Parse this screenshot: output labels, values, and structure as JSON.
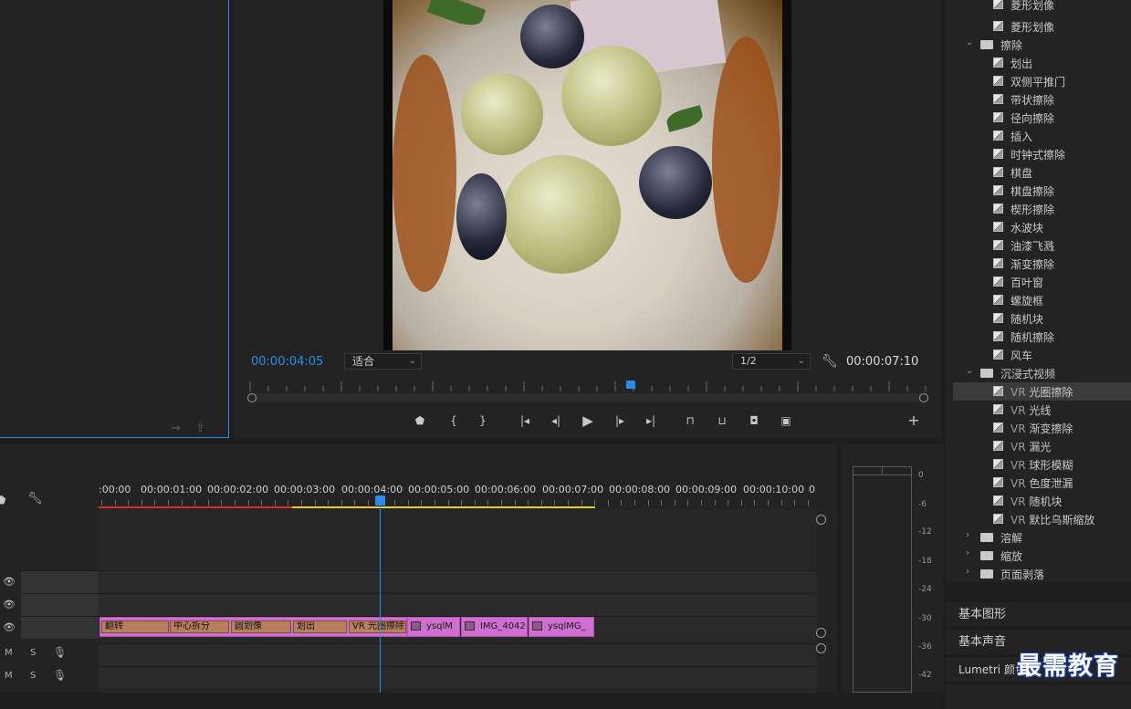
{
  "program_monitor": {
    "timecode_current": "00:00:04:05",
    "fit_select": "适合",
    "resolution_select": "1/2",
    "timecode_duration": "00:00:07:10",
    "playhead_fraction": 0.567
  },
  "timeline": {
    "ruler_labels": [
      ":00:00",
      "00:00:01:00",
      "00:00:02:00",
      "00:00:03:00",
      "00:00:04:00",
      "00:00:05:00",
      "00:00:06:00",
      "00:00:07:00",
      "00:00:08:00",
      "00:00:09:00",
      "00:00:10:00",
      "0"
    ],
    "transitions": [
      "翻转",
      "中心拆分",
      "圆划像",
      "划出",
      "VR 光圈擦除"
    ],
    "clips": [
      "ysqlM",
      "IMG_4042",
      "ysqlMG_"
    ],
    "track_m": "M",
    "track_s": "S"
  },
  "audio_meter": {
    "db_labels": [
      "0",
      "-6",
      "-12",
      "-18",
      "-24",
      "-30",
      "-36",
      "-42"
    ]
  },
  "effects": {
    "top_items": [
      "菱形划像",
      "菱形划像"
    ],
    "wipe_folder": "擦除",
    "wipe_items": [
      "划出",
      "双侧平推门",
      "带状擦除",
      "径向擦除",
      "插入",
      "时钟式擦除",
      "棋盘",
      "棋盘擦除",
      "楔形擦除",
      "水波块",
      "油漆飞溅",
      "渐变擦除",
      "百叶窗",
      "螺旋框",
      "随机块",
      "随机擦除",
      "风车"
    ],
    "immersive_folder": "沉浸式视频",
    "vr_prefix": "VR",
    "immersive_items": [
      "光圈擦除",
      "光线",
      "渐变擦除",
      "漏光",
      "球形模糊",
      "色度泄漏",
      "随机块",
      "默比乌斯缩放"
    ],
    "collapsed_folders": [
      "溶解",
      "缩放",
      "页面剥落"
    ]
  },
  "side_panels": {
    "basic_graphics": "基本图形",
    "basic_sound": "基本声音",
    "lumetri": "Lumetri 颜色"
  },
  "watermark": "最需教育",
  "colors": {
    "accent": "#2d8ceb",
    "clip": "#cf6fd0",
    "transition": "#b6805f",
    "work_area_red": "#e02b2b",
    "work_area_yellow": "#e6d12a"
  }
}
